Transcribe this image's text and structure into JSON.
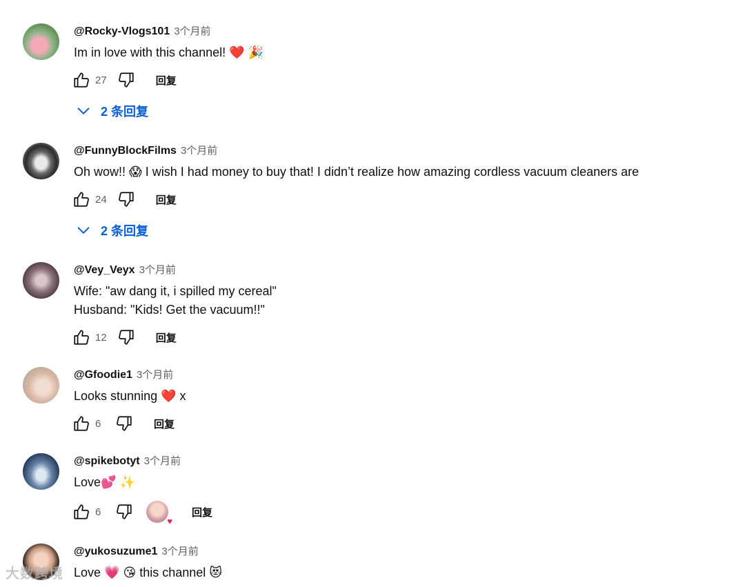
{
  "comments": [
    {
      "author": "@Rocky-Vlogs101",
      "time": "3个月前",
      "lines": [
        "Im in love with this channel! ❤️ 🎉"
      ],
      "likes": "27",
      "reply_label": "回复",
      "replies_label": "2 条回复"
    },
    {
      "author": "@FunnyBlockFilms",
      "time": "3个月前",
      "lines": [
        "Oh wow!! 😱 I wish I had money to buy that! I didn’t realize how amazing cordless vacuum cleaners are"
      ],
      "likes": "24",
      "reply_label": "回复",
      "replies_label": "2 条回复"
    },
    {
      "author": "@Vey_Veyx",
      "time": "3个月前",
      "lines": [
        "Wife: \"aw dang it, i spilled my cereal\"",
        "Husband: \"Kids! Get the vacuum!!\""
      ],
      "likes": "12",
      "reply_label": "回复"
    },
    {
      "author": "@Gfoodie1",
      "time": "3个月前",
      "lines": [
        "Looks stunning ❤️ x"
      ],
      "likes": "6",
      "reply_label": "回复"
    },
    {
      "author": "@spikebotyt",
      "time": "3个月前",
      "lines": [
        "Love💕 ✨"
      ],
      "likes": "6",
      "reply_label": "回复"
    },
    {
      "author": "@yukosuzume1",
      "time": "3个月前",
      "lines": [
        "Love 💗 😘 this channel 😻"
      ]
    }
  ],
  "icons": {
    "like": "thumbs-up-icon",
    "dislike": "thumbs-down-icon",
    "expand": "chevron-down-icon",
    "creator_heart": "heart-icon"
  },
  "colors": {
    "link_blue": "#065fd4",
    "meta_gray": "#606060",
    "text": "#0f0f0f",
    "heart": "#e0245e"
  },
  "watermark": "大数跨境"
}
